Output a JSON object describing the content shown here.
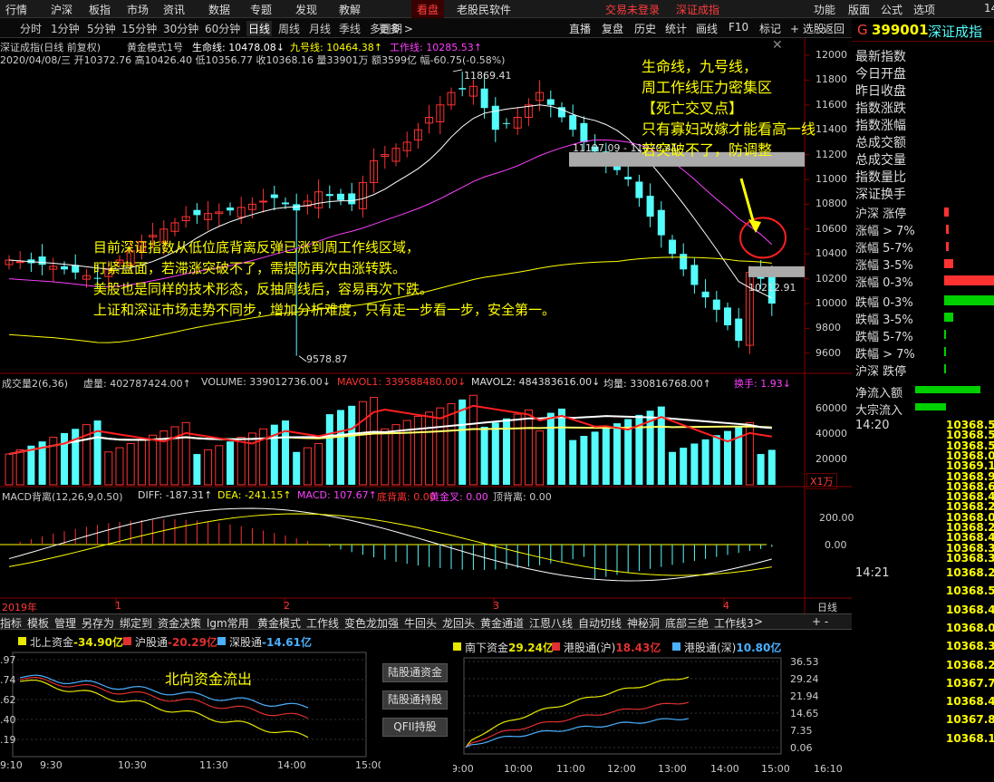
{
  "menu": {
    "items": [
      "行情",
      "沪深",
      "板指",
      "市场",
      "资讯",
      "数据",
      "专题",
      "发现",
      "教解",
      "看盘",
      "老股民软件"
    ],
    "status_left": "交易未登录",
    "status_right": "深证成指",
    "right_items": [
      "功能",
      "版面",
      "公式",
      "选项"
    ],
    "corner": "14"
  },
  "periods": [
    "分时",
    "1分钟",
    "5分钟",
    "15分钟",
    "30分钟",
    "60分钟",
    "日线",
    "周线",
    "月线",
    "季线",
    "多周期",
    "更多 >"
  ],
  "active_period": "日线",
  "toolbar": [
    "直播",
    "复盘",
    "历史",
    "统计",
    "画线",
    "F10",
    "标记",
    "+ 选股",
    "返回"
  ],
  "stock": {
    "market_tag": "G",
    "code": "399001",
    "name": "深证成指"
  },
  "chart_header": {
    "line1": {
      "title": "深证成指(日线 前复权)",
      "formula": "黄金模式1号",
      "life": "生命线: 10478.08↓",
      "nine": "九号线: 10464.38↑",
      "week": "工作线: 10285.53↑"
    },
    "line2": "2020/04/08/三 开10372.76 高10426.40 低10356.77 收10368.16 量33901万 额3599亿 幅-60.75(-0.58%)"
  },
  "price_axis": [
    "12000",
    "11800",
    "11600",
    "11400",
    "11200",
    "11000",
    "10800",
    "10600",
    "10400",
    "10200",
    "10000",
    "9800",
    "9600"
  ],
  "price_labels": {
    "high": "11869.41",
    "low": "9578.87",
    "resist": "11197.09 - 11070.41",
    "support": "10212.91"
  },
  "annotations": {
    "top": [
      "生命线，九号线，",
      "周工作线压力密集区",
      "【死亡交叉点】",
      "只有寡妇改嫁才能看高一线",
      "若突破不了，防调整"
    ],
    "main": [
      "目前深证指数从低位底背离反弹已涨到周工作线区域，",
      "盯紧盘面，若滞涨突破不了，需提防再次由涨转跌。",
      "美股也是同样的技术形态，反抽周线后，容易再次下跌。",
      "上证和深证市场走势不同步，增加分析难度，只有走一步看一步，安全第一。"
    ],
    "north": "北向资金流出"
  },
  "volume_header": {
    "title": "成交量2(6,36)",
    "xu": "虚量: 402787424.00↑",
    "vol": "VOLUME: 339012736.00↓",
    "mavol1": "MAVOL1: 339588480.00↓",
    "mavol2": "MAVOL2: 484383616.00↓",
    "avg": "均量: 330816768.00↑",
    "turn": "换手: 1.93↓"
  },
  "volume_axis": [
    "60000",
    "40000",
    "20000"
  ],
  "volume_unit": "X1万",
  "macd_header": {
    "title": "MACD背离(12,26,9,0.50)",
    "diff": "DIFF: -187.31↑",
    "dea": "DEA: -241.15↑",
    "macd": "MACD: 107.67↑",
    "bottom": "底背离: 0.00",
    "gold": "黄金叉: 0.00",
    "top": "顶背离: 0.00"
  },
  "macd_axis": [
    "200.00",
    "0.00"
  ],
  "time_axis": {
    "year": "2019年",
    "m1": "1",
    "m2": "2",
    "m3": "3",
    "m4": "4",
    "period": "日线"
  },
  "right_list": [
    "最新指数",
    "今日开盘",
    "昨日收盘",
    "指数涨跌",
    "指数涨幅",
    "总成交额",
    "总成交量",
    "指数量比",
    "深证换手"
  ],
  "breadth": {
    "up_header": "沪深 涨停",
    "rows": [
      "涨幅 > 7%",
      "涨幅 5-7%",
      "涨幅 3-5%",
      "涨幅 0-3%",
      "跌幅 0-3%",
      "跌幅 3-5%",
      "跌幅 5-7%",
      "跌幅 > 7%"
    ],
    "down_footer": "沪深 跌停"
  },
  "flow": [
    "净流入额",
    "大宗流入"
  ],
  "ticks": {
    "t1": "14:20",
    "t2": "14:21",
    "values1": [
      "10368.5",
      "10368.5",
      "10368.5",
      "10368.0",
      "10369.1",
      "10368.9",
      "10368.6",
      "10368.4",
      "10368.2",
      "10368.0",
      "10368.2",
      "10368.4",
      "10368.3",
      "10368.3"
    ],
    "values2": [
      "10368.2",
      "10368.5",
      "10368.4",
      "10368.0",
      "10368.3",
      "10368.2",
      "10367.7",
      "10368.4",
      "10367.8",
      "10368.1"
    ]
  },
  "func_bar": [
    "指标",
    "模板",
    "管理",
    "另存为",
    "绑定到",
    "资金决策",
    "lgm常用",
    "黄金模式",
    "工作线",
    "变色龙加强",
    "牛回头",
    "龙回头",
    "黄金通道",
    "江恩八线",
    "自动切线",
    "神秘洞",
    "底部三绝",
    "工作线3",
    ">"
  ],
  "func_plus": "+ -",
  "north": {
    "legend": [
      {
        "label": "北上资金",
        "value": "-34.90亿",
        "color": "#e8e800"
      },
      {
        "label": "沪股通",
        "value": "-20.29亿",
        "color": "#e03030"
      },
      {
        "label": "深股通",
        "value": "-14.61亿",
        "color": "#4ab0ff"
      }
    ],
    "yaxis": [
      ".97",
      ".74",
      ".62",
      ".40",
      ".19"
    ],
    "xaxis": [
      "9:10",
      "9:30",
      "10:30",
      "11:30",
      "14:00",
      "15:00"
    ]
  },
  "mid_buttons": [
    "陆股通资金",
    "陆股通持股",
    "QFII持股"
  ],
  "south": {
    "legend": [
      {
        "label": "南下资金",
        "value": "29.24亿",
        "color": "#e8e800"
      },
      {
        "label": "港股通(沪)",
        "value": "18.43亿",
        "color": "#e03030"
      },
      {
        "label": "港股通(深)",
        "value": "10.80亿",
        "color": "#4ab0ff"
      }
    ],
    "yaxis": [
      "36.53",
      "29.24",
      "21.94",
      "14.65",
      "7.35",
      "0.06"
    ],
    "xaxis": [
      "9:00",
      "10:00",
      "11:00",
      "12:00",
      "13:00",
      "14:00",
      "15:00",
      "16:10"
    ]
  },
  "colors": {
    "up": "#ff3232",
    "down": "#54fcfc",
    "yellow": "#ffff00",
    "magenta": "#ff40ff",
    "white": "#ffffff",
    "red_text": "#ff3c3c"
  }
}
